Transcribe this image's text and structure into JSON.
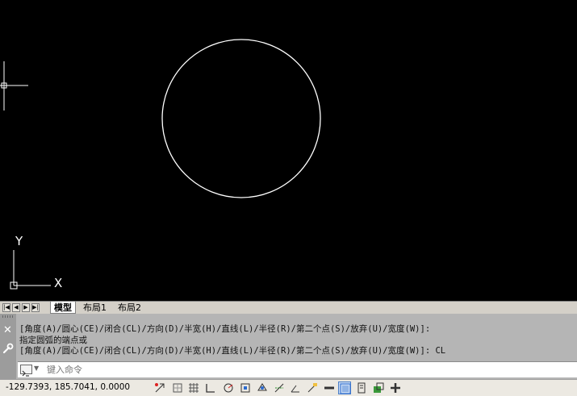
{
  "tabs": {
    "model": "模型",
    "layout1": "布局1",
    "layout2": "布局2"
  },
  "ucs": {
    "x_label": "X",
    "y_label": "Y"
  },
  "command": {
    "history": [
      "[角度(A)/圆心(CE)/闭合(CL)/方向(D)/半宽(H)/直线(L)/半径(R)/第二个点(S)/放弃(U)/宽度(W)]:",
      "指定圆弧的端点或",
      "[角度(A)/圆心(CE)/闭合(CL)/方向(D)/半宽(H)/直线(L)/半径(R)/第二个点(S)/放弃(U)/宽度(W)]: CL"
    ],
    "placeholder": "键入命令",
    "close_symbol": "✕"
  },
  "status": {
    "coordinates": "-129.7393, 185.7041, 0.0000",
    "buttons": [
      {
        "name": "infer-constraints-button",
        "active": false
      },
      {
        "name": "snap-mode-button",
        "active": false
      },
      {
        "name": "grid-display-button",
        "active": false
      },
      {
        "name": "ortho-mode-button",
        "active": false
      },
      {
        "name": "polar-tracking-button",
        "active": false
      },
      {
        "name": "object-snap-button",
        "active": false
      },
      {
        "name": "3d-object-snap-button",
        "active": false
      },
      {
        "name": "object-snap-tracking-button",
        "active": false
      },
      {
        "name": "dynamic-ucs-button",
        "active": false
      },
      {
        "name": "dynamic-input-button",
        "active": false
      },
      {
        "name": "lineweight-button",
        "active": false
      },
      {
        "name": "show-hide-transparency-button",
        "active": false
      },
      {
        "name": "quick-properties-button",
        "active": true
      },
      {
        "name": "selection-cycling-button",
        "active": false
      },
      {
        "name": "annotation-monitor-button",
        "active": false
      },
      {
        "name": "add-button",
        "active": false
      }
    ]
  },
  "colors": {
    "canvas": "#000000",
    "entity": "#ffffff",
    "command_bg": "#b5b5b5",
    "status_bg": "#ece9e2",
    "active_button": "#c7d9f2"
  }
}
